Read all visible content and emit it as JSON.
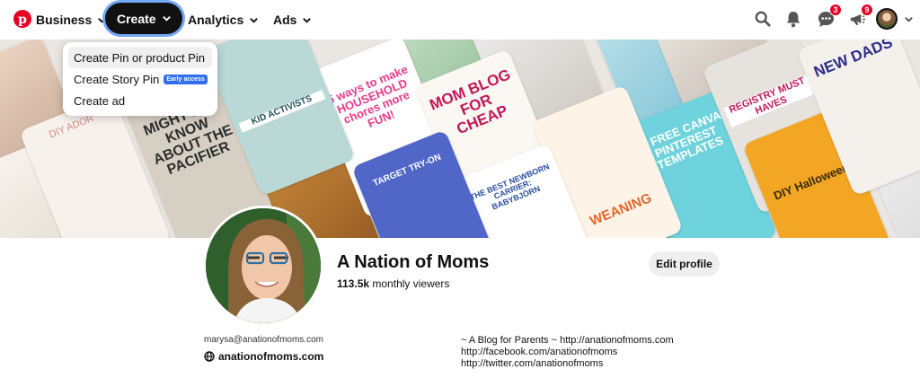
{
  "nav": {
    "business_label": "Business",
    "create_label": "Create",
    "analytics_label": "Analytics",
    "ads_label": "Ads",
    "messages_badge": "3",
    "updates_badge": "9",
    "icons": [
      "pinterest-logo",
      "search-icon",
      "bell-icon",
      "chat-icon",
      "megaphone-icon",
      "avatar",
      "chevron-down-icon"
    ],
    "accent_color": "#e60023"
  },
  "create_menu": {
    "items": [
      {
        "label": "Create Pin or product Pin"
      },
      {
        "label": "Create Story Pin",
        "badge": "Early access"
      },
      {
        "label": "Create ad"
      }
    ]
  },
  "cover": {
    "tiles": [
      {
        "text": "5 ways to make HOUSEHOLD chores more FUN!"
      },
      {
        "text": "MOM BLOG FOR CHEAP"
      },
      {
        "text": "MIGHT NOT KNOW ABOUT THE PACIFIER"
      },
      {
        "text": "KID ACTIVISTS"
      },
      {
        "text": "5 FREE CANVA PINTEREST TEMPLATES"
      },
      {
        "text": "WEANING"
      },
      {
        "text": "REGISTRY MUST HAVES"
      },
      {
        "text": "DIY Halloween"
      },
      {
        "text": "NEW DADS"
      },
      {
        "text": "THE BEST NEWBORN CARRIER: BABYBJÖRN"
      },
      {
        "text": "TARGET TRY-ON"
      },
      {
        "text": "DIY ADOR"
      }
    ]
  },
  "profile": {
    "name": "A Nation of Moms",
    "viewers_count": "113.5k",
    "viewers_label": "monthly viewers",
    "edit_label": "Edit profile",
    "email": "marysa@anationofmoms.com",
    "website": "anationofmoms.com",
    "about_lines": [
      "~ A Blog for Parents ~ http://anationofmoms.com",
      "http://facebook.com/anationofmoms",
      "http://twitter.com/anationofmoms"
    ]
  }
}
